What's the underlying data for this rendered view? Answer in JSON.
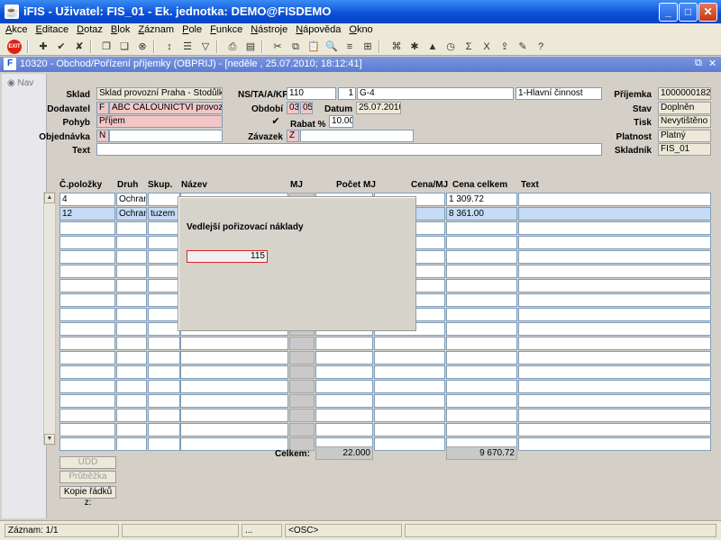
{
  "window": {
    "title": "iFIS - Uživatel: FIS_01 - Ek. jednotka: DEMO@FISDEMO"
  },
  "menu": [
    {
      "u": "A",
      "rest": "kce"
    },
    {
      "u": "E",
      "rest": "ditace"
    },
    {
      "u": "D",
      "rest": "otaz"
    },
    {
      "u": "B",
      "rest": "lok"
    },
    {
      "u": "Z",
      "rest": "áznam"
    },
    {
      "u": "P",
      "rest": "ole"
    },
    {
      "u": "F",
      "rest": "unkce"
    },
    {
      "u": "N",
      "rest": "ástroje"
    },
    {
      "u": "N",
      "rest": "ápověda"
    },
    {
      "u": "O",
      "rest": "kno"
    }
  ],
  "toolbar": {
    "exit_label": "EXIT"
  },
  "form": {
    "title": "10320 - Obchod/Pořízení příjemky (OBPRIJ) - [neděle , 25.07.2010; 18:12:41]"
  },
  "nav": {
    "label": "Nav"
  },
  "header": {
    "sklad_label": "Sklad",
    "sklad": "Sklad provozní Praha - Stodůlky",
    "dodavatel_label": "Dodavatel",
    "dodavatel_code": "F",
    "dodavatel": "ABC CALOUNICTVÍ provozovna",
    "pohyb_label": "Pohyb",
    "pohyb": "Příjem",
    "objednavka_label": "Objednávka",
    "objednavka_code": "N",
    "objednavka": "",
    "text_label": "Text",
    "text": "",
    "ns_label": "NS/TA/A/KP",
    "ns": "110",
    "ta": "1",
    "a": "G-4",
    "kp": "1-Hlavní činnost",
    "obdobi_label": "Období",
    "obdobi_m": "03",
    "obdobi_y": "05",
    "datum_label": "Datum",
    "datum": "25.07.2010",
    "rabat_label": "Rabat %",
    "rabat": "10.00",
    "rabat_checked": "✔",
    "zavazek_label": "Závazek",
    "zavazek_code": "Z",
    "zavazek": "",
    "prijemka_label": "Příjemka",
    "prijemka": "1000000182",
    "stav_label": "Stav",
    "stav": "Doplněn",
    "tisk_label": "Tisk",
    "tisk": "Nevytištěno",
    "platnost_label": "Platnost",
    "platnost": "Platný",
    "skladnik_label": "Skladník",
    "skladnik": "FIS_01"
  },
  "grid": {
    "columns": [
      "Č.položky",
      "Druh",
      "Skup.",
      "Název",
      "MJ",
      "Počet MJ",
      "Cena/MJ",
      "Cena celkem",
      "Text"
    ],
    "rows": [
      {
        "polozka": "4",
        "druh": "Ochranné",
        "skup": "",
        "cena_celkem": "1 309.72"
      },
      {
        "polozka": "12",
        "druh": "Ochranné",
        "skup": "tuzem",
        "cena_celkem": "8 361.00"
      }
    ],
    "empty_rows": 16
  },
  "dialog": {
    "title": "Vedlejší pořizovací náklady",
    "value": "115"
  },
  "totals": {
    "label": "Celkem:",
    "pocet": "22.000",
    "cena": "9 670.72"
  },
  "buttons": {
    "udd": "UDD",
    "pruvezka": "Průběžka",
    "kopie": "Kopie řádků z:"
  },
  "status": {
    "zaznam": "Záznam: 1/1",
    "dots": "...",
    "osc": "<OSC>"
  }
}
